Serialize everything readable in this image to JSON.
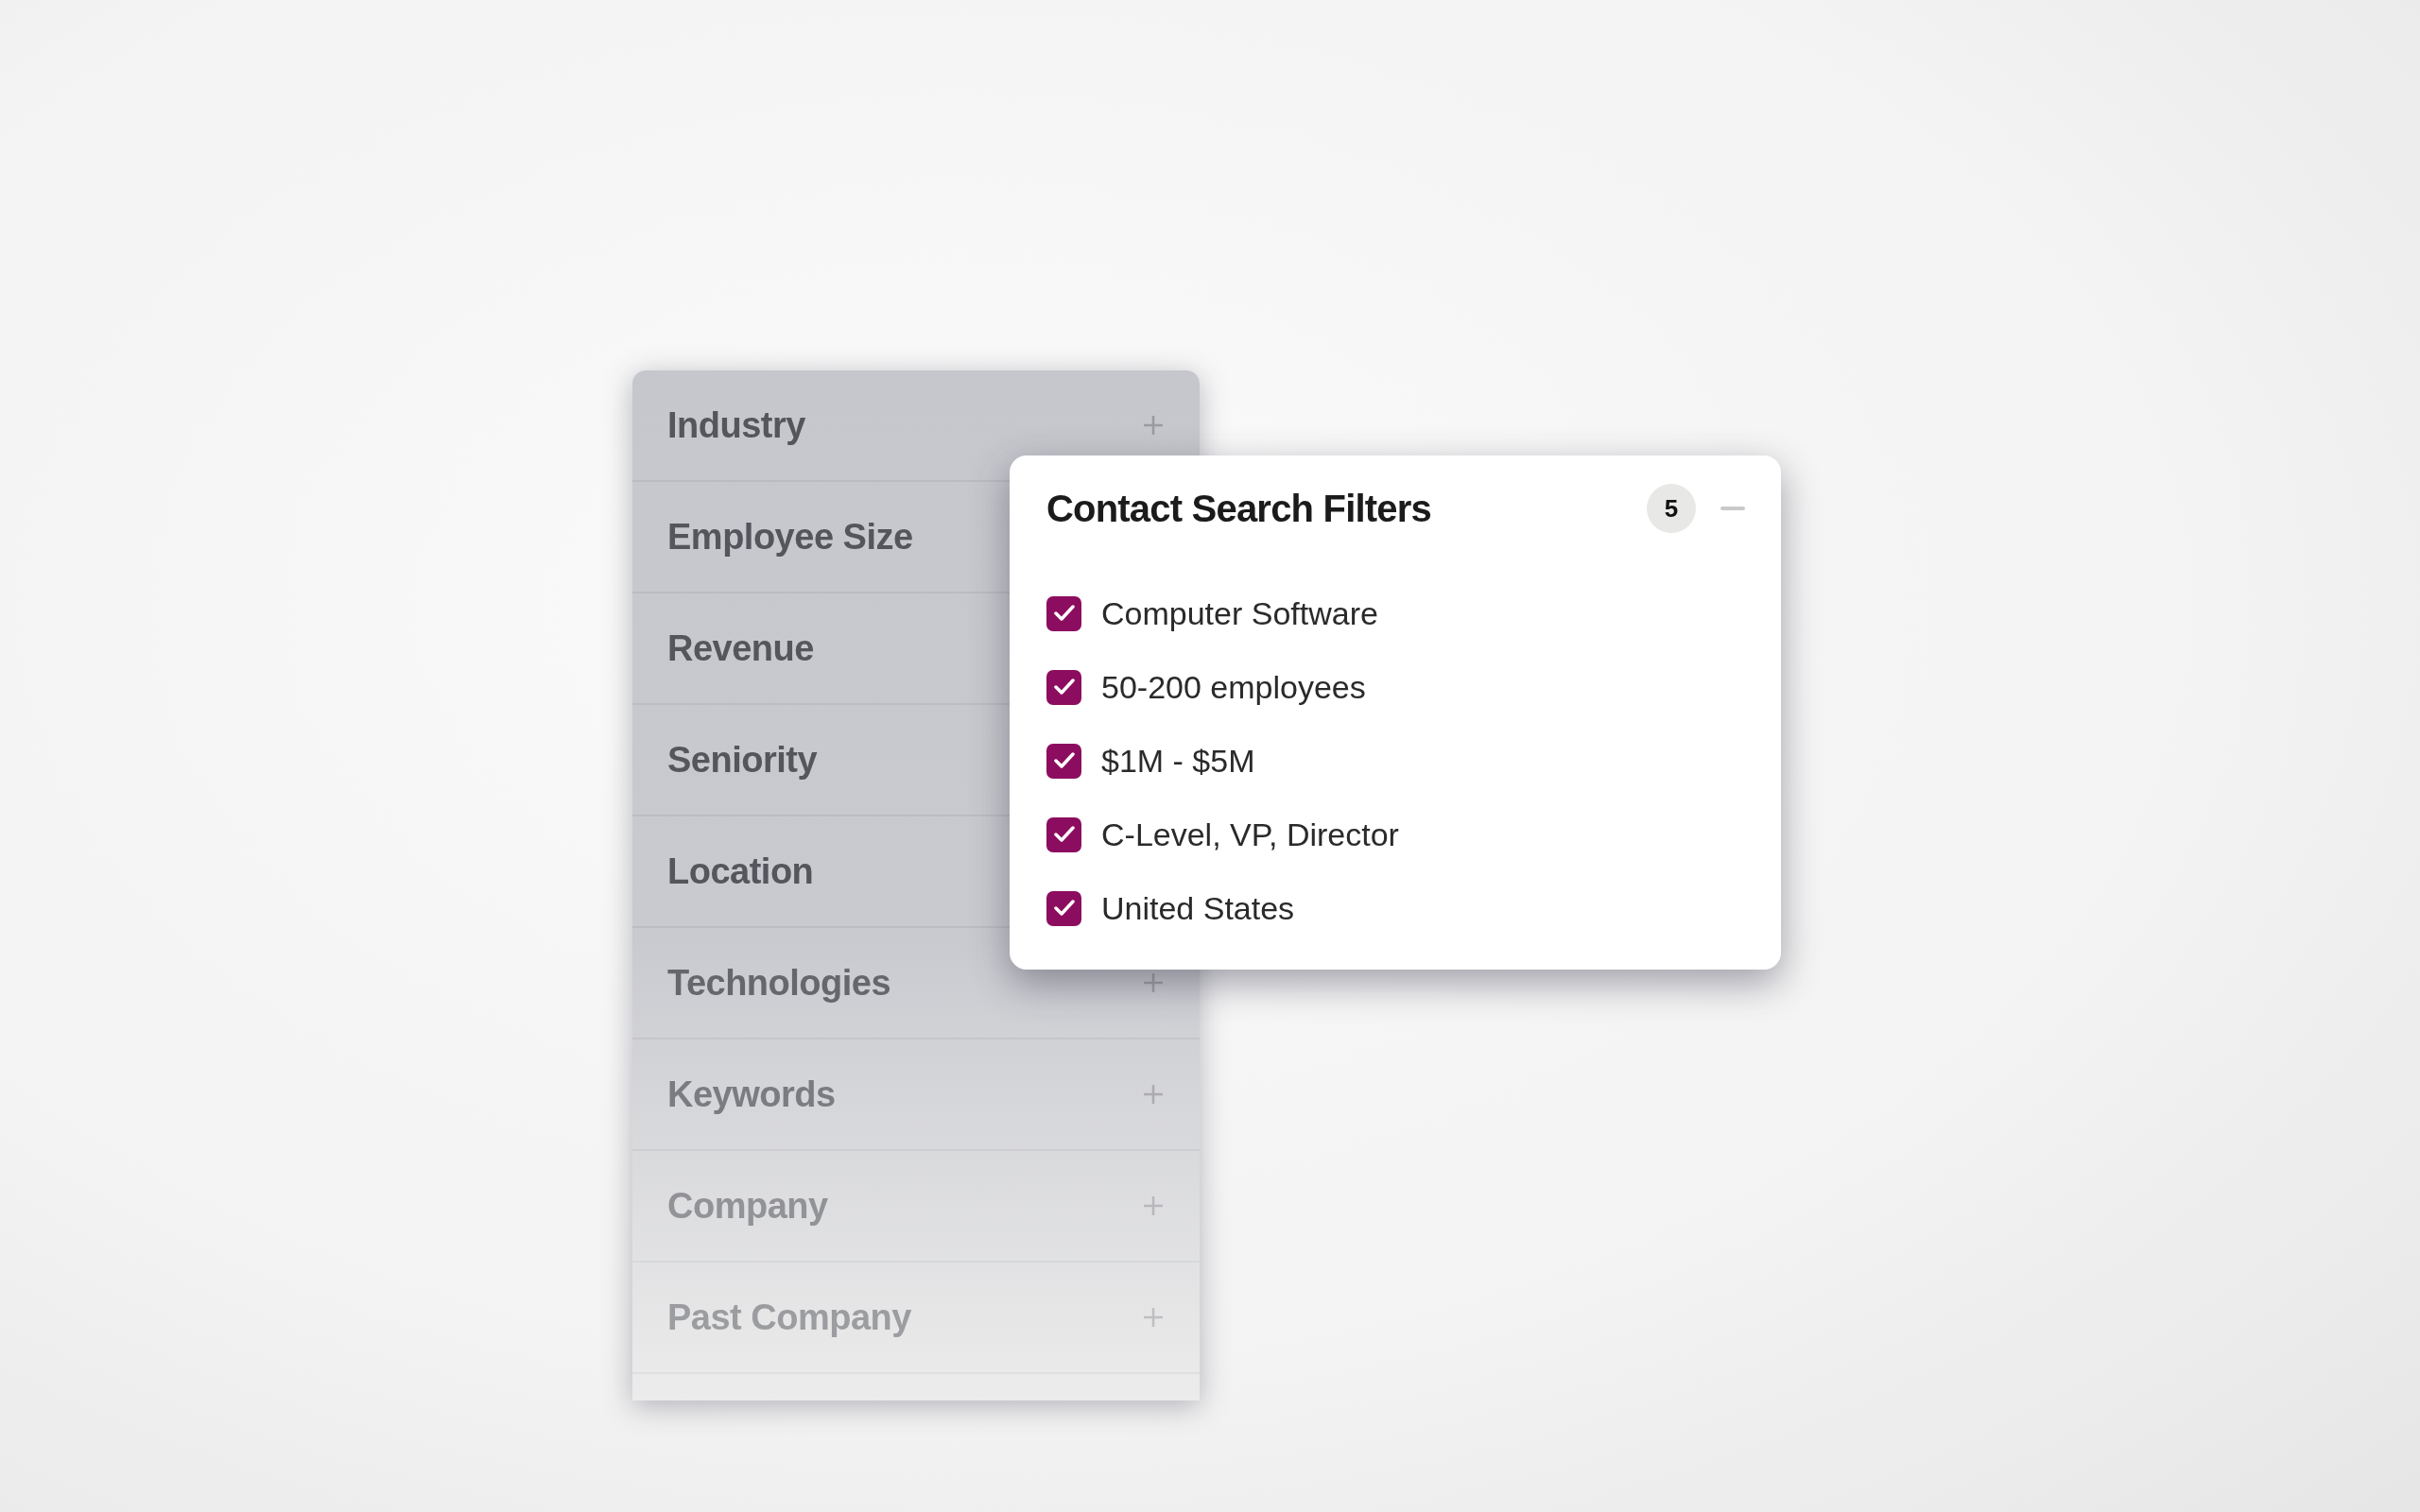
{
  "filter_list": {
    "items": [
      {
        "label": "Industry"
      },
      {
        "label": "Employee Size"
      },
      {
        "label": "Revenue"
      },
      {
        "label": "Seniority"
      },
      {
        "label": "Location"
      },
      {
        "label": "Technologies"
      },
      {
        "label": "Keywords"
      },
      {
        "label": "Company"
      },
      {
        "label": "Past Company"
      }
    ]
  },
  "filters_popup": {
    "title": "Contact Search Filters",
    "count": "5",
    "items": [
      {
        "label": "Computer Software",
        "checked": true
      },
      {
        "label": "50-200 employees",
        "checked": true
      },
      {
        "label": "$1M - $5M",
        "checked": true
      },
      {
        "label": "C-Level, VP, Director",
        "checked": true
      },
      {
        "label": "United States",
        "checked": true
      }
    ]
  }
}
